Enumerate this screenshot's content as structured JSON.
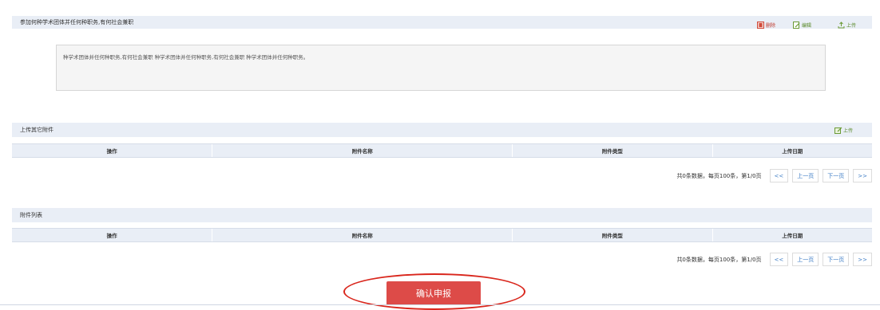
{
  "section1": {
    "title": "参加何种学术团体并任何种职务,有何社会兼职",
    "buttons": {
      "delete": "删除",
      "edit": "编辑",
      "upload": "上传"
    },
    "content": "种学术团体并任何种职务,有何社会兼职 种学术团体并任何种职务,有何社会兼职 种学术团体并任何种职务。"
  },
  "section2": {
    "title": "上传其它附件",
    "upload": "上传",
    "columns": [
      "操作",
      "附件名称",
      "附件类型",
      "上传日期"
    ],
    "pager": {
      "info": "共0条数据，每页100条，第1/0页",
      "first": "<<",
      "prev": "上一页",
      "next": "下一页",
      "last": ">>"
    }
  },
  "section3": {
    "title": "附件列表",
    "columns": [
      "操作",
      "附件名称",
      "附件类型",
      "上传日期"
    ],
    "pager": {
      "info": "共0条数据，每页100条，第1/0页",
      "first": "<<",
      "prev": "上一页",
      "next": "下一页",
      "last": ">>"
    }
  },
  "submit": {
    "label": "确认申报"
  },
  "colors": {
    "header_bg": "#e9eef6",
    "submit_bg": "#dd4b48",
    "highlight_ellipse": "#d9261c",
    "link_blue": "#3b7bc4"
  }
}
